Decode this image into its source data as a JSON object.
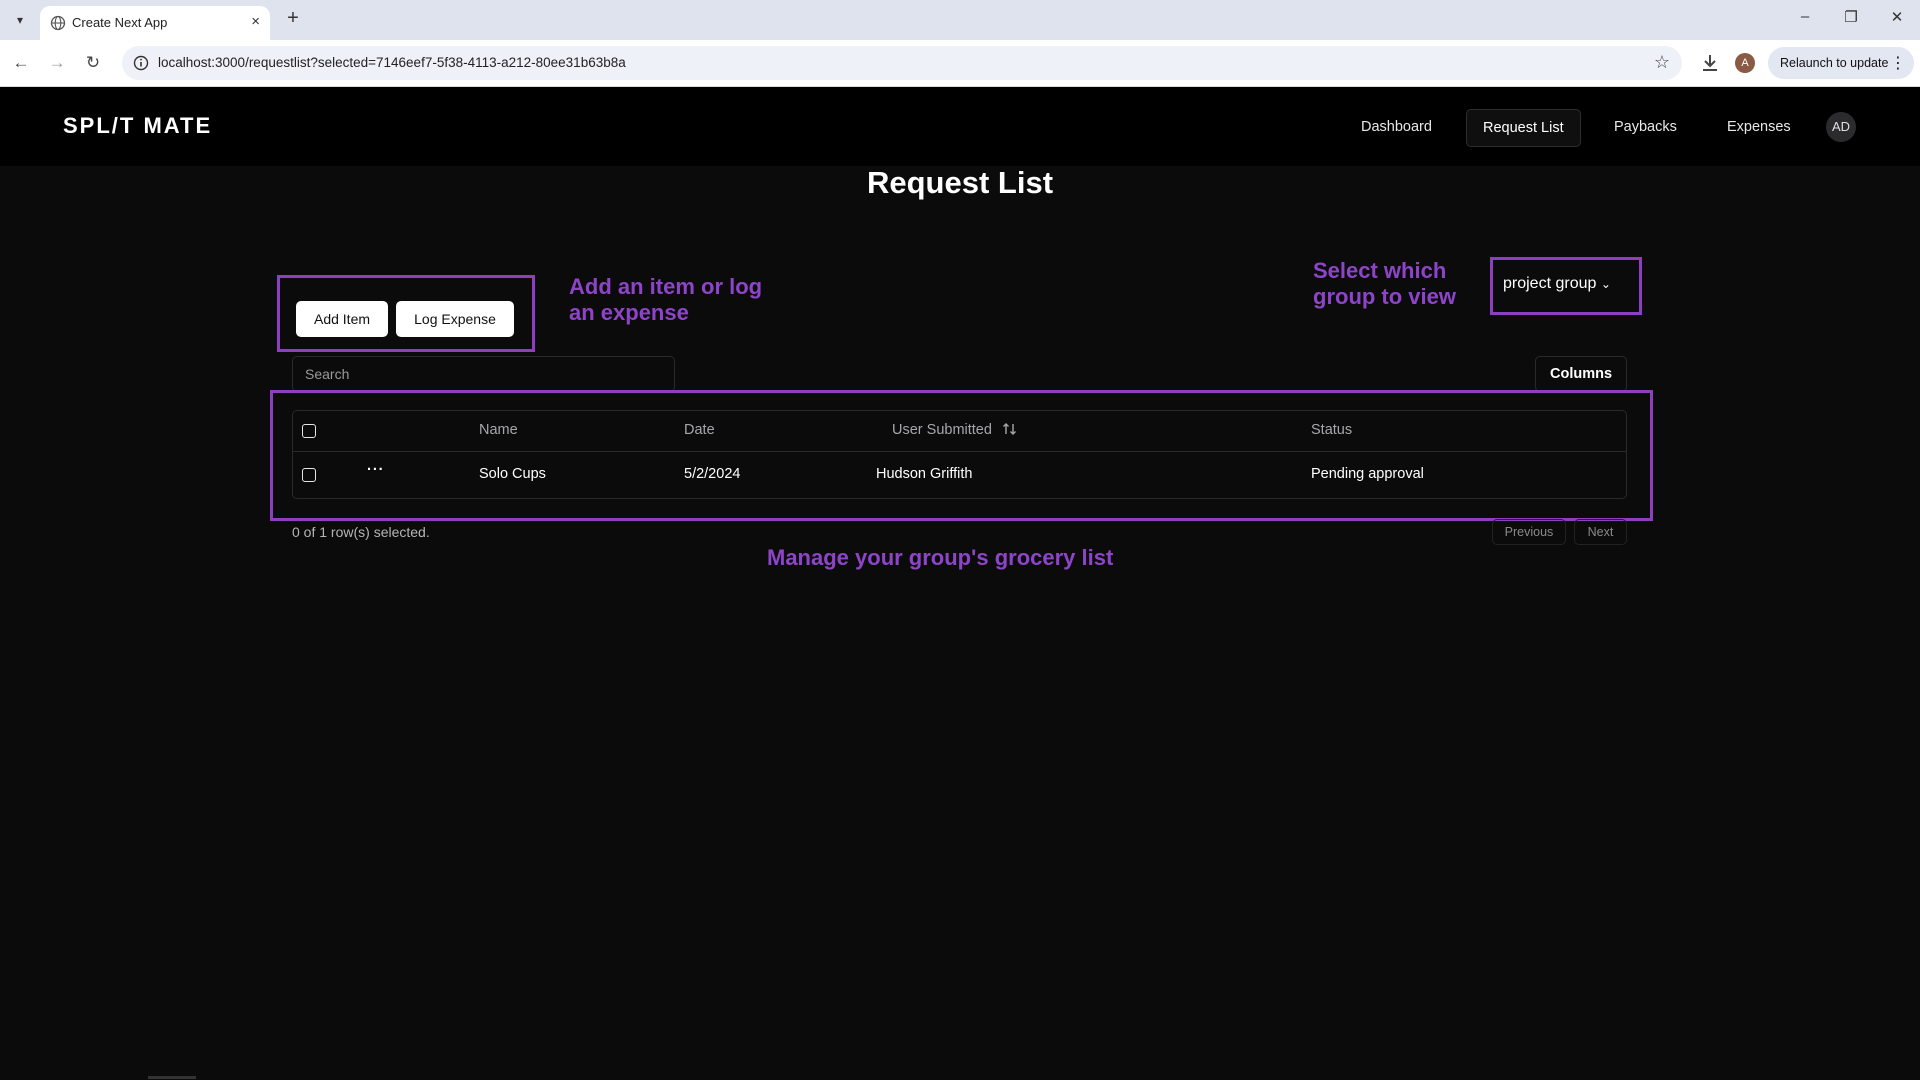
{
  "browser": {
    "tab_title": "Create Next App",
    "url": "localhost:3000/requestlist?selected=7146eef7-5f38-4113-a212-80ee31b63b8a",
    "relaunch_label": "Relaunch to update",
    "profile_initial": "A"
  },
  "header": {
    "logo": "SPL/T MATE",
    "nav": [
      "Dashboard",
      "Request List",
      "Paybacks",
      "Expenses"
    ],
    "active_nav": "Request List",
    "avatar_initials": "AD"
  },
  "page": {
    "title": "Request List",
    "add_item_label": "Add Item",
    "log_expense_label": "Log Expense",
    "group_select_value": "project group",
    "search_placeholder": "Search",
    "columns_label": "Columns"
  },
  "annotations": {
    "add_hint_line1": "Add an item or log",
    "add_hint_line2": "an expense",
    "group_hint_line1": "Select which",
    "group_hint_line2": "group to view",
    "list_hint": "Manage your group's grocery list"
  },
  "table": {
    "headers": [
      "Name",
      "Date",
      "User Submitted",
      "Status"
    ],
    "rows": [
      {
        "name": "Solo Cups",
        "date": "5/2/2024",
        "user": "Hudson Griffith",
        "status": "Pending approval"
      }
    ],
    "selection_text": "0 of 1 row(s) selected.",
    "previous_label": "Previous",
    "next_label": "Next"
  },
  "colors": {
    "accent_purple": "#8e3fbf",
    "background": "#0b0b0c"
  }
}
